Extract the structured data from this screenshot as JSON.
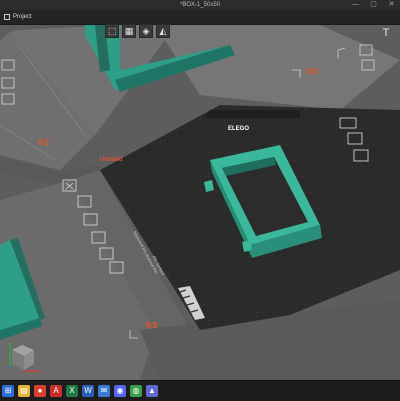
{
  "window": {
    "title": "*BOX-1_50x50",
    "controls": [
      "—",
      "▢",
      "✕"
    ]
  },
  "menu": {
    "project_label": "Project"
  },
  "toolbar": {
    "tools": [
      {
        "name": "box-view-icon",
        "glyph": "⬚"
      },
      {
        "name": "grid-icon",
        "glyph": "▦"
      },
      {
        "name": "layers-icon",
        "glyph": "◈"
      },
      {
        "name": "paint-icon",
        "glyph": "◭"
      }
    ],
    "text_tool_glyph": "T"
  },
  "plates": {
    "plate_02": "02",
    "plate_03": "03",
    "plate_05": "05",
    "active_plate_name": "Untitled",
    "bed_brand": "ELEGO",
    "bed_text_1": "Neptune4 Pro textured PEI",
    "bed_text_2": "PEI Surface"
  },
  "colors": {
    "accent": "#e0552b",
    "model": "#2f9e88",
    "bed": "#2a2a2a"
  },
  "taskbar": {
    "apps": [
      {
        "name": "start-icon",
        "glyph": "⊞",
        "color": "#2a6ed6"
      },
      {
        "name": "files-icon",
        "glyph": "▤",
        "color": "#e6b43b"
      },
      {
        "name": "browser-icon",
        "glyph": "●",
        "color": "#d93e2f"
      },
      {
        "name": "pdf-icon",
        "glyph": "A",
        "color": "#c9302c"
      },
      {
        "name": "excel-icon",
        "glyph": "X",
        "color": "#1f7a43"
      },
      {
        "name": "word-icon",
        "glyph": "W",
        "color": "#2b5fb8"
      },
      {
        "name": "mail-icon",
        "glyph": "✉",
        "color": "#3a7bd5"
      },
      {
        "name": "discord-icon",
        "glyph": "◉",
        "color": "#5865f2"
      },
      {
        "name": "chrome-icon",
        "glyph": "◍",
        "color": "#3a9e48"
      },
      {
        "name": "slicer-icon",
        "glyph": "▲",
        "color": "#5f6ad1"
      }
    ]
  }
}
